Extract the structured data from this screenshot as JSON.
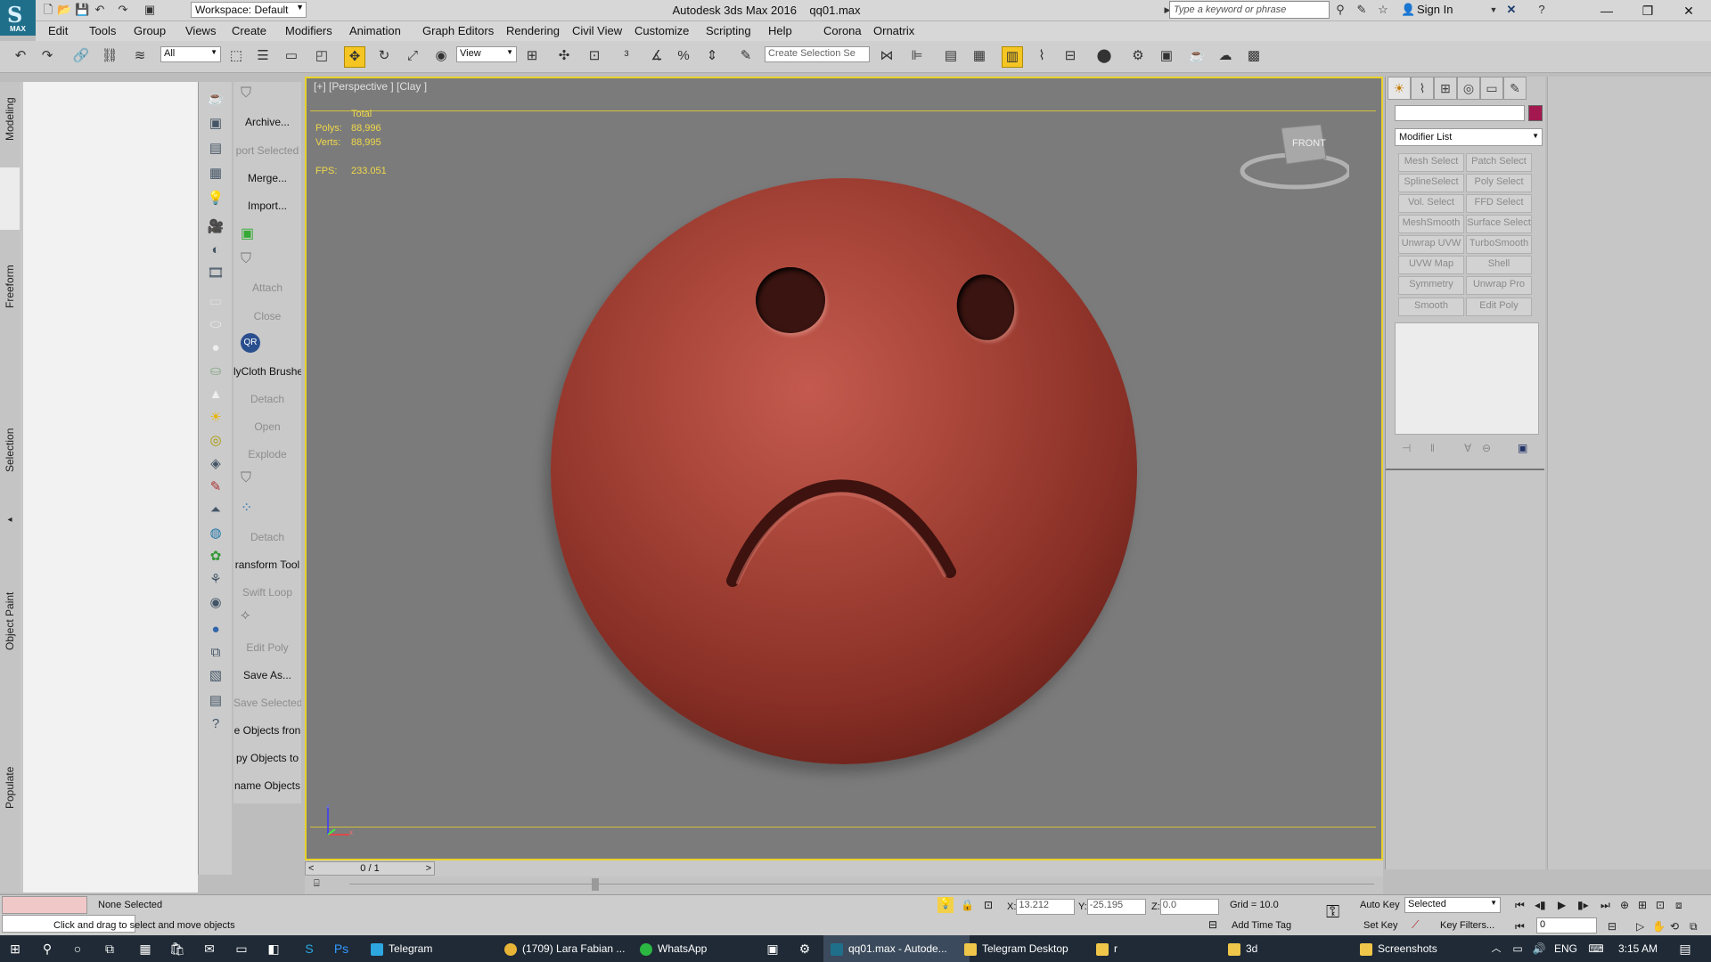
{
  "window": {
    "app_title": "Autodesk 3ds Max 2016",
    "file_name": "qq01.max",
    "workspace": "Workspace: Default",
    "search_placeholder": "Type a keyword or phrase",
    "sign_in": "Sign In",
    "logo_text": "MAX"
  },
  "menu": [
    "Edit",
    "Tools",
    "Group",
    "Views",
    "Create",
    "Modifiers",
    "Animation",
    "Graph Editors",
    "Rendering",
    "Civil View",
    "Customize",
    "Scripting",
    "Help",
    "Corona",
    "Ornatrix"
  ],
  "toolbar": {
    "selection_filter": "All",
    "reference_coord": "View",
    "named_selection_placeholder": "Create Selection Se"
  },
  "ribbon_tabs": [
    "Modeling",
    "Freeform",
    "Selection",
    "Object Paint",
    "Populate"
  ],
  "ribbon_labels": [
    {
      "label": "Archive...",
      "disabled": false
    },
    {
      "label": "port Selected",
      "disabled": true
    },
    {
      "label": "Merge...",
      "disabled": false
    },
    {
      "label": "Import...",
      "disabled": false
    },
    {
      "label": "Attach",
      "disabled": true
    },
    {
      "label": "Close",
      "disabled": true
    },
    {
      "label": "lyCloth Brushe",
      "disabled": false
    },
    {
      "label": "Detach",
      "disabled": true
    },
    {
      "label": "Open",
      "disabled": true
    },
    {
      "label": "Explode",
      "disabled": true
    },
    {
      "label": "Detach",
      "disabled": true
    },
    {
      "label": "ransform Tool",
      "disabled": false
    },
    {
      "label": "Swift Loop",
      "disabled": true
    },
    {
      "label": "Edit Poly",
      "disabled": true
    },
    {
      "label": "Save As...",
      "disabled": false
    },
    {
      "label": "Save Selected",
      "disabled": true
    },
    {
      "label": "e Objects fron",
      "disabled": false
    },
    {
      "label": "py Objects to",
      "disabled": false
    },
    {
      "label": "name Objects",
      "disabled": false
    }
  ],
  "viewport": {
    "label": "[+] [Perspective ] [Clay ]",
    "stats_header": "Total",
    "polys_label": "Polys:",
    "polys_value": "88,996",
    "verts_label": "Verts:",
    "verts_value": "88,995",
    "fps_label": "FPS:",
    "fps_value": "233.051",
    "navcube_label": "FRONT"
  },
  "timeline": {
    "frame": "0 / 1",
    "prev": "<",
    "next": ">"
  },
  "command_panel": {
    "modifier_list": "Modifier List",
    "object_color": "#a3184f",
    "modifier_buttons": [
      "Mesh Select",
      "Patch Select",
      "SplineSelect",
      "Poly Select",
      "Vol. Select",
      "FFD Select",
      "MeshSmooth",
      "Surface Select",
      "Unwrap UVW",
      "TurboSmooth",
      "UVW Map",
      "Shell",
      "Symmetry",
      "Unwrap Pro",
      "Smooth",
      "Edit Poly"
    ]
  },
  "status": {
    "selection": "None Selected",
    "prompt": "Click and drag to select and move objects",
    "x_label": "X:",
    "x_value": "13.212",
    "y_label": "Y:",
    "y_value": "-25.195",
    "z_label": "Z:",
    "z_value": "0.0",
    "grid": "Grid = 10.0",
    "add_time_tag": "Add Time Tag",
    "auto_key": "Auto Key",
    "set_key": "Set Key",
    "key_mode": "Selected",
    "key_filters": "Key Filters...",
    "current_frame": "0"
  },
  "taskbar": {
    "apps": [
      {
        "label": "Telegram",
        "color": "#2ea6e0",
        "active": false
      },
      {
        "label": "(1709) Lara Fabian ...",
        "color": "#e8b437",
        "active": false
      },
      {
        "label": "WhatsApp",
        "color": "#2bb741",
        "active": false
      },
      {
        "label": "qq01.max - Autode...",
        "color": "#1f6f8b",
        "active": true
      },
      {
        "label": "Telegram Desktop",
        "color": "#f0c64a",
        "active": false
      },
      {
        "label": "r",
        "color": "#f0c64a",
        "active": false
      },
      {
        "label": "3d",
        "color": "#f0c64a",
        "active": false
      },
      {
        "label": "Screenshots",
        "color": "#f0c64a",
        "active": false
      }
    ],
    "language": "ENG",
    "time": "3:15 AM"
  }
}
